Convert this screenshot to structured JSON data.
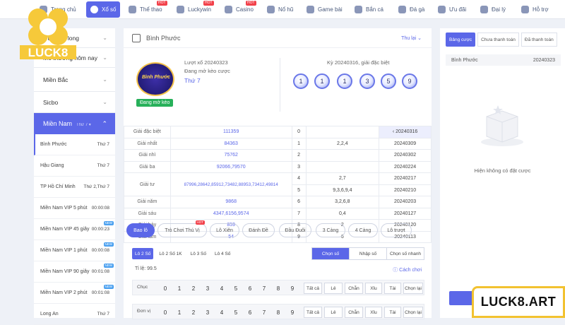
{
  "brand": {
    "logo_text": "LUCK8",
    "site": "LUCK8.ART"
  },
  "nav": [
    {
      "label": "Trang chủ",
      "hot": false
    },
    {
      "label": "Xổ số",
      "hot": false
    },
    {
      "label": "Thể thao",
      "hot": true
    },
    {
      "label": "Luckywin",
      "hot": true
    },
    {
      "label": "Casino",
      "hot": true
    },
    {
      "label": "Nổ hũ",
      "hot": false
    },
    {
      "label": "Game bài",
      "hot": false
    },
    {
      "label": "Bắn cá",
      "hot": false
    },
    {
      "label": "Đá gà",
      "hot": false
    },
    {
      "label": "Ưu đãi",
      "hot": false
    },
    {
      "label": "Đại lý",
      "hot": false
    },
    {
      "label": "Hỗ trợ",
      "hot": false
    }
  ],
  "hot_label": "HOT",
  "new_label": "NEW",
  "sidebar": {
    "groups": [
      "Xổ số truyền thống",
      "Miền Bắc",
      "Sicbo"
    ],
    "group_first_visible": "c trường long",
    "group_second": "Mổ thưởng hôm nay",
    "active": {
      "label": "Miền Nam",
      "sub": "Thứ 7 ▾"
    },
    "items": [
      {
        "label": "Bình Phước",
        "day": "Thứ 7",
        "new": false
      },
      {
        "label": "Hậu Giang",
        "day": "Thứ 7",
        "new": false
      },
      {
        "label": "TP Hồ Chí Minh",
        "day": "Thứ 2,Thứ 7",
        "new": false
      },
      {
        "label": "Miền Nam VIP 5 phút",
        "day": "00:00:08",
        "new": false
      },
      {
        "label": "Miền Nam VIP 45 giây",
        "day": "00:00:23",
        "new": true
      },
      {
        "label": "Miền Nam VIP 1 phút",
        "day": "00:00:08",
        "new": true
      },
      {
        "label": "Miền Nam VIP 90 giây",
        "day": "00:01:08",
        "new": true
      },
      {
        "label": "Miền Nam VIP 2 phút",
        "day": "00:01:08",
        "new": true
      },
      {
        "label": "Long An",
        "day": "Thứ 7",
        "new": false
      }
    ]
  },
  "main": {
    "title": "Bình Phước",
    "collapse": "Thu lại",
    "badge_text": "Bình Phước",
    "open_tag": "Đang mở kèo",
    "draw_line": "Lượt xổ 20240323",
    "status_line": "Đang mở kèo cược",
    "weekday": "Thứ 7",
    "prev_label": "Kỳ 20240316, giải đặc biệt",
    "balls": [
      "1",
      "1",
      "1",
      "3",
      "5",
      "9"
    ],
    "results": [
      {
        "prize": "Giải đặc biệt",
        "num": "111359",
        "digit": "0",
        "tail": "",
        "date": "20240316"
      },
      {
        "prize": "Giải nhất",
        "num": "84363",
        "digit": "1",
        "tail": "2,2,4",
        "date": "20240309"
      },
      {
        "prize": "Giải nhì",
        "num": "75762",
        "digit": "2",
        "tail": "",
        "date": "20240302"
      },
      {
        "prize": "Giải ba",
        "num": "92066,79570",
        "digit": "3",
        "tail": "",
        "date": "20240224"
      },
      {
        "prize": "Giải tư",
        "num": "87996,28642,85912,73482,88953,73412,49814",
        "digit": "4",
        "tail": "2,7",
        "date": "20240217"
      },
      {
        "prize": "",
        "num": "",
        "digit": "5",
        "tail": "9,3,6,9,4",
        "date": "20240210"
      },
      {
        "prize": "Giải năm",
        "num": "9868",
        "digit": "6",
        "tail": "3,2,6,8",
        "date": "20240203"
      },
      {
        "prize": "Giải sáu",
        "num": "4347,6156,9574",
        "digit": "7",
        "tail": "0,4",
        "date": "20240127"
      },
      {
        "prize": "Giải bảy",
        "num": "859",
        "digit": "8",
        "tail": "2",
        "date": "20240120"
      },
      {
        "prize": "Giải tám",
        "num": "54",
        "digit": "9",
        "tail": "6",
        "date": "20240113"
      }
    ],
    "tabs": [
      "Bao lô",
      "Trò Chơi Thú Vị",
      "Lô Xiên",
      "Đánh Đề",
      "Đầu Đuôi",
      "3 Càng",
      "4 Càng",
      "Lô trượt"
    ],
    "subtabs": [
      "Lô 2 Số",
      "Lô 2 Số 1K",
      "Lô 3 Số",
      "Lô 4 Số"
    ],
    "segments": [
      "Chọn số",
      "Nhập số",
      "Chọn số nhanh"
    ],
    "rate": "Tỉ lệ: 99.5",
    "howto": "Cách chơi",
    "pick_rows": [
      "Chục",
      "Đơn vị"
    ],
    "digits": [
      "0",
      "1",
      "2",
      "3",
      "4",
      "5",
      "6",
      "7",
      "8",
      "9"
    ],
    "quick": [
      "Tất cả",
      "Lẻ",
      "Chẵn",
      "Xỉu",
      "Tài",
      "Chọn lại"
    ]
  },
  "right": {
    "tabs": [
      "Bảng cược",
      "Chưa thanh toán",
      "Đã thanh toán"
    ],
    "row": {
      "name": "Bình Phước",
      "draw": "20240323"
    },
    "empty_text": "Hiện không có đặt cược"
  }
}
